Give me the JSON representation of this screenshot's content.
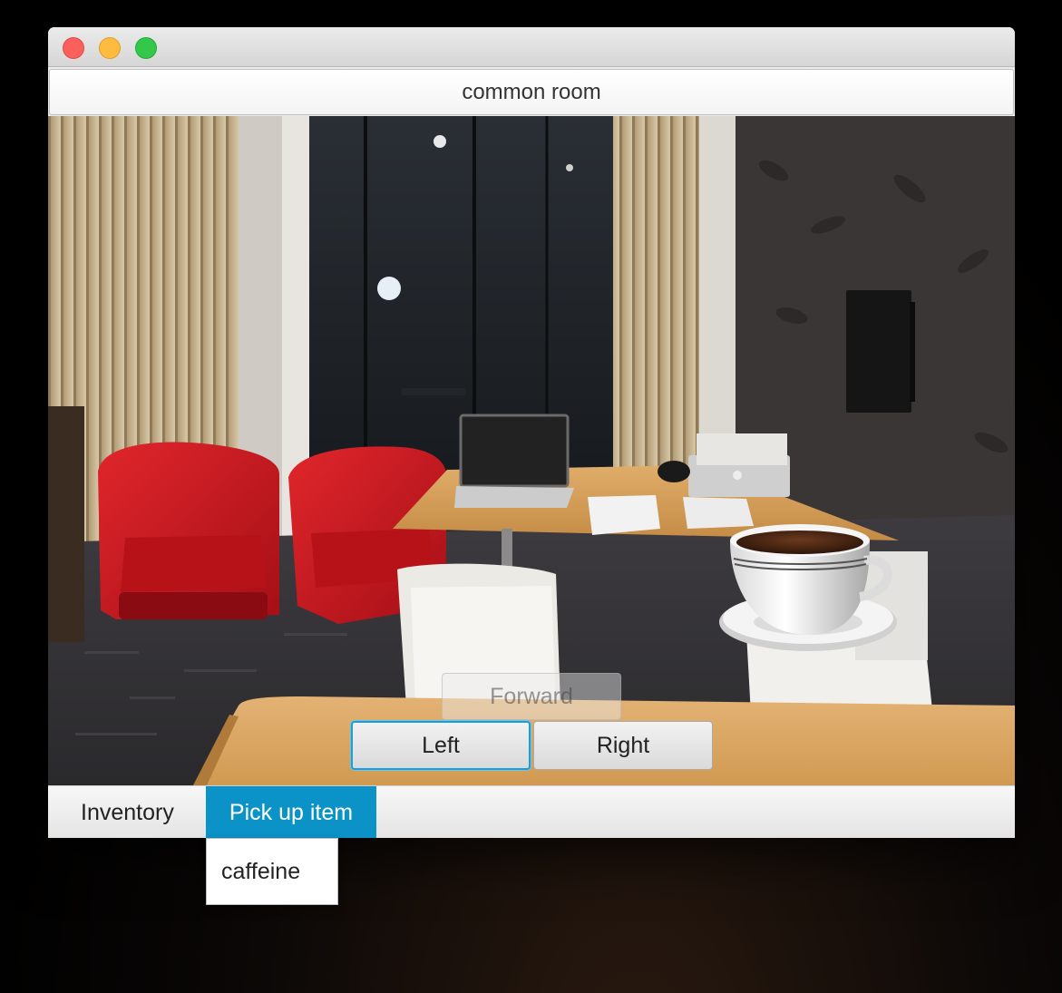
{
  "room": {
    "title": "common room"
  },
  "navigation": {
    "forward_label": "Forward",
    "left_label": "Left",
    "right_label": "Right"
  },
  "menu": {
    "inventory_label": "Inventory",
    "pickup_label": "Pick up item",
    "pickup_options": [
      "caffeine"
    ]
  },
  "colors": {
    "accent": "#0b93c8",
    "focus_ring": "#1b9fd6",
    "chair_red": "#d0121b"
  },
  "icons": [
    "close-icon",
    "minimize-icon",
    "maximize-icon",
    "coffee-cup-icon"
  ]
}
